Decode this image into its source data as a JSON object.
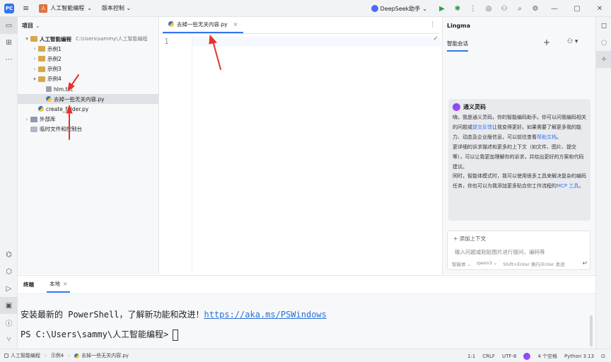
{
  "titlebar": {
    "menu_icon": "hamburger-icon",
    "project_badge": "人",
    "project_name": "人工智能编程",
    "version_control": "版本控制",
    "model_name": "DeepSeek助手",
    "icons": [
      "run-icon",
      "debug-icon",
      "more-icon",
      "ai-icon",
      "add-user-icon",
      "search-icon",
      "settings-icon"
    ],
    "window_controls": [
      "—",
      "▢",
      "✕"
    ]
  },
  "left_strip": {
    "icons": [
      "folder-icon",
      "structure-icon",
      "more-dots-icon",
      "python-console-icon",
      "services-icon",
      "run-tool-icon",
      "terminal-icon",
      "problems-icon",
      "git-icon"
    ]
  },
  "project_panel": {
    "title": "项目",
    "tree": [
      {
        "name": "人工智能编程",
        "path": "C:\\Users\\sammy\\人工智能编程",
        "indent": 0,
        "arrow": "▾",
        "type": "folder",
        "bold": true
      },
      {
        "name": "示例1",
        "indent": 1,
        "arrow": "›",
        "type": "folder"
      },
      {
        "name": "示例2",
        "indent": 1,
        "arrow": "›",
        "type": "folder"
      },
      {
        "name": "示例3",
        "indent": 1,
        "arrow": "›",
        "type": "folder"
      },
      {
        "name": "示例4",
        "indent": 1,
        "arrow": "▾",
        "type": "folder"
      },
      {
        "name": "hlm.txt",
        "indent": 2,
        "arrow": "",
        "type": "txt"
      },
      {
        "name": "去掉一些无关内容.py",
        "indent": 2,
        "arrow": "",
        "type": "py",
        "selected": true
      },
      {
        "name": "create_folder.py",
        "indent": 1,
        "arrow": "",
        "type": "py"
      },
      {
        "name": "外部库",
        "indent": 0,
        "arrow": "›",
        "type": "lib"
      },
      {
        "name": "临时文件和控制台",
        "indent": 0,
        "arrow": "",
        "type": "scratch"
      }
    ]
  },
  "editor": {
    "tab_label": "去掉一些无关内容.py",
    "line_number": "1",
    "check_mark": "✓"
  },
  "lingma": {
    "title": "Lingma",
    "tab": "智能会话",
    "card_title": "通义灵码",
    "p1_a": "嗨，我是通义灵码，你的智能编码助手。你可以问我编码相关的问题或",
    "p1_link1": "提交反馈",
    "p1_b": "让我变得更好。如果需要了解更多我的能力、动态及企业版信息，可以前往查看",
    "p1_link2": "帮助文档",
    "p1_c": "。",
    "p2": "更详细的诉求描述和更多的上下文（如文件、图片、提交等），可以让我更加理解你的诉求，并给出更好的方案和代码建议。",
    "p3_a": "同时，智能体模式时，我可以使用很多工具来解决复杂的编码任务，你也可以为我添加更多贴合你工作流程的",
    "p3_link": "MCP 工具",
    "p3_b": "。",
    "add_context": "+ 添加上下文",
    "input_placeholder": "输入问题或粘贴图片进行提问，编码等",
    "mode": "智能体 ⌄",
    "model": "qwen3 ⌄",
    "hint": "Shift+Enter 换行/Enter 发送",
    "send": "↵"
  },
  "terminal": {
    "tab1": "终端",
    "tab2": "本地",
    "line1_text": "安装最新的 PowerShell，了解新功能和改进！",
    "line1_url": "https://aka.ms/PSWindows",
    "prompt": "PS C:\\Users\\sammy\\人工智能编程>"
  },
  "status": {
    "crumb1": "人工智能编程",
    "crumb2": "示例4",
    "crumb3": "去掉一些无关内容.py",
    "position": "1:1",
    "line_sep": "CRLF",
    "encoding": "UTF-8",
    "indent": "4 个空格",
    "interpreter": "Python 3.13"
  },
  "colors": {
    "accent": "#3574f0",
    "arrow": "#e8312a"
  }
}
